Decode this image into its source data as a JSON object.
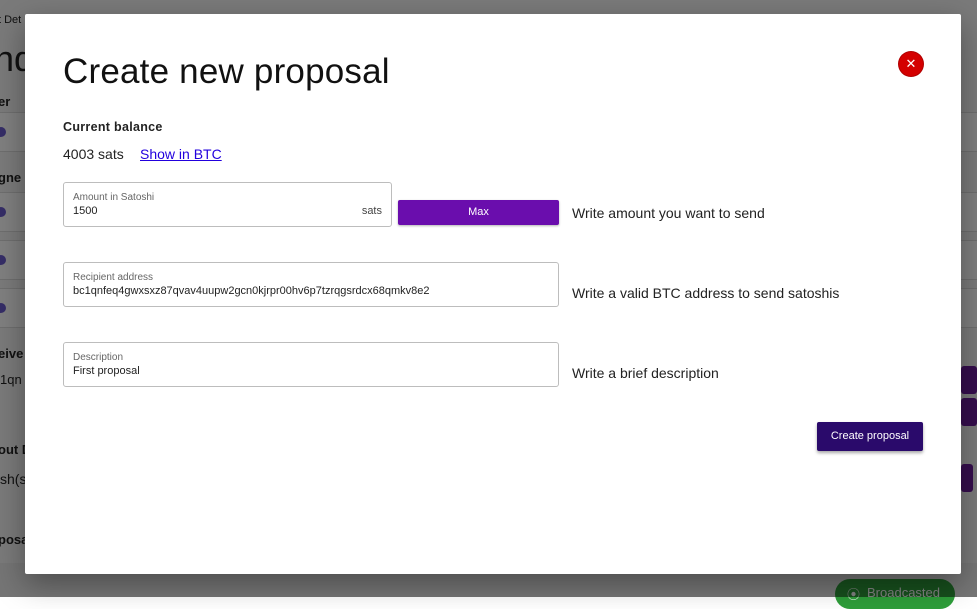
{
  "background": {
    "texts": [
      "t Det",
      "nd",
      "er",
      "gne",
      "eive",
      "1qn",
      "out D",
      "sh(s",
      "posa"
    ],
    "badge_label": "Broadcasted",
    "badge_icon": "broadcast-icon"
  },
  "modal": {
    "title": "Create new proposal",
    "close_icon": "close-icon",
    "balance": {
      "label": "Current balance",
      "value": "4003 sats",
      "toggle_link": "Show in BTC"
    },
    "amount_field": {
      "label": "Amount in Satoshi",
      "value": "1500",
      "suffix": "sats"
    },
    "max_button": "Max",
    "amount_hint": "Write amount you want to send",
    "recipient_field": {
      "label": "Recipient address",
      "value": "bc1qnfeq4gwxsxz87qvav4uupw2gcn0kjrpr00hv6p7tzrqgsrdcx68qmkv8e2"
    },
    "recipient_hint": "Write a valid BTC address to send satoshis",
    "description_field": {
      "label": "Description",
      "value": "First proposal"
    },
    "description_hint": "Write a brief description",
    "create_button": "Create proposal"
  },
  "colors": {
    "primary": "#6a0dad",
    "create_button": "#2a0a6b",
    "close_button": "#d40000",
    "link": "#2200dd",
    "badge": "#2e9e3a"
  }
}
